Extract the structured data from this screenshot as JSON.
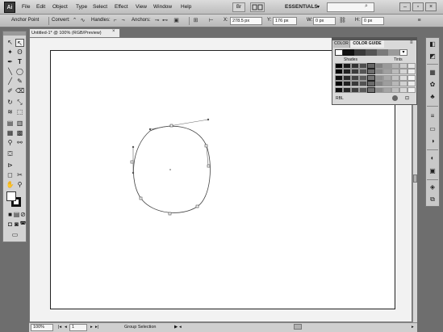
{
  "app": {
    "logo": "Ai"
  },
  "menu": [
    "File",
    "Edit",
    "Object",
    "Type",
    "Select",
    "Effect",
    "View",
    "Window",
    "Help"
  ],
  "menubar": {
    "bridge": "Br",
    "workspace": "ESSENTIALS"
  },
  "control_bar": {
    "tool_name": "Anchor Point",
    "convert_label": "Convert:",
    "handles_label": "Handles:",
    "anchors_label": "Anchors:",
    "x_label": "X:",
    "x_value": "278.5 px",
    "y_label": "Y:",
    "y_value": "176 px",
    "w_label": "W:",
    "w_value": "0 px",
    "h_label": "H:",
    "h_value": "0 px"
  },
  "document": {
    "tab_title": "Untitled-1* @ 100% (RGB/Preview)"
  },
  "status_bar": {
    "zoom": "100%",
    "artboard": "1",
    "tool": "Group Selection"
  },
  "color_panel": {
    "tabs": [
      "COLOR",
      "COLOR GUIDE"
    ],
    "active_tab": "COLOR GUIDE",
    "shades_label": "Shades",
    "tints_label": "Tints",
    "mode_label": "RBL",
    "strip_colors": [
      "#ffffff",
      "#111111",
      "#3a3a3a",
      "#555555",
      "#7a7a7a",
      "#9a9a9a",
      "#bdbdbd"
    ],
    "grid_colors": [
      [
        "#000000",
        "#1a1a1a",
        "#333333",
        "#4d4d4d",
        "#666666",
        "#808080",
        "#999999",
        "#b3b3b3",
        "#cccccc",
        "#e6e6e6"
      ],
      [
        "#080808",
        "#222222",
        "#3b3b3b",
        "#555555",
        "#6e6e6e",
        "#888888",
        "#a1a1a1",
        "#bbbbbb",
        "#d4d4d4",
        "#eeeeee"
      ],
      [
        "#101010",
        "#2a2a2a",
        "#434343",
        "#5d5d5d",
        "#767676",
        "#909090",
        "#a9a9a9",
        "#c3c3c3",
        "#dcdcdc",
        "#f5f5f5"
      ],
      [
        "#050505",
        "#1f1f1f",
        "#383838",
        "#525252",
        "#6b6b6b",
        "#858585",
        "#9e9e9e",
        "#b8b8b8",
        "#d1d1d1",
        "#ebebeb"
      ],
      [
        "#0c0c0c",
        "#262626",
        "#3f3f3f",
        "#595959",
        "#727272",
        "#8c8c8c",
        "#a5a5a5",
        "#bfbfbf",
        "#d8d8d8",
        "#f2f2f2"
      ]
    ]
  }
}
